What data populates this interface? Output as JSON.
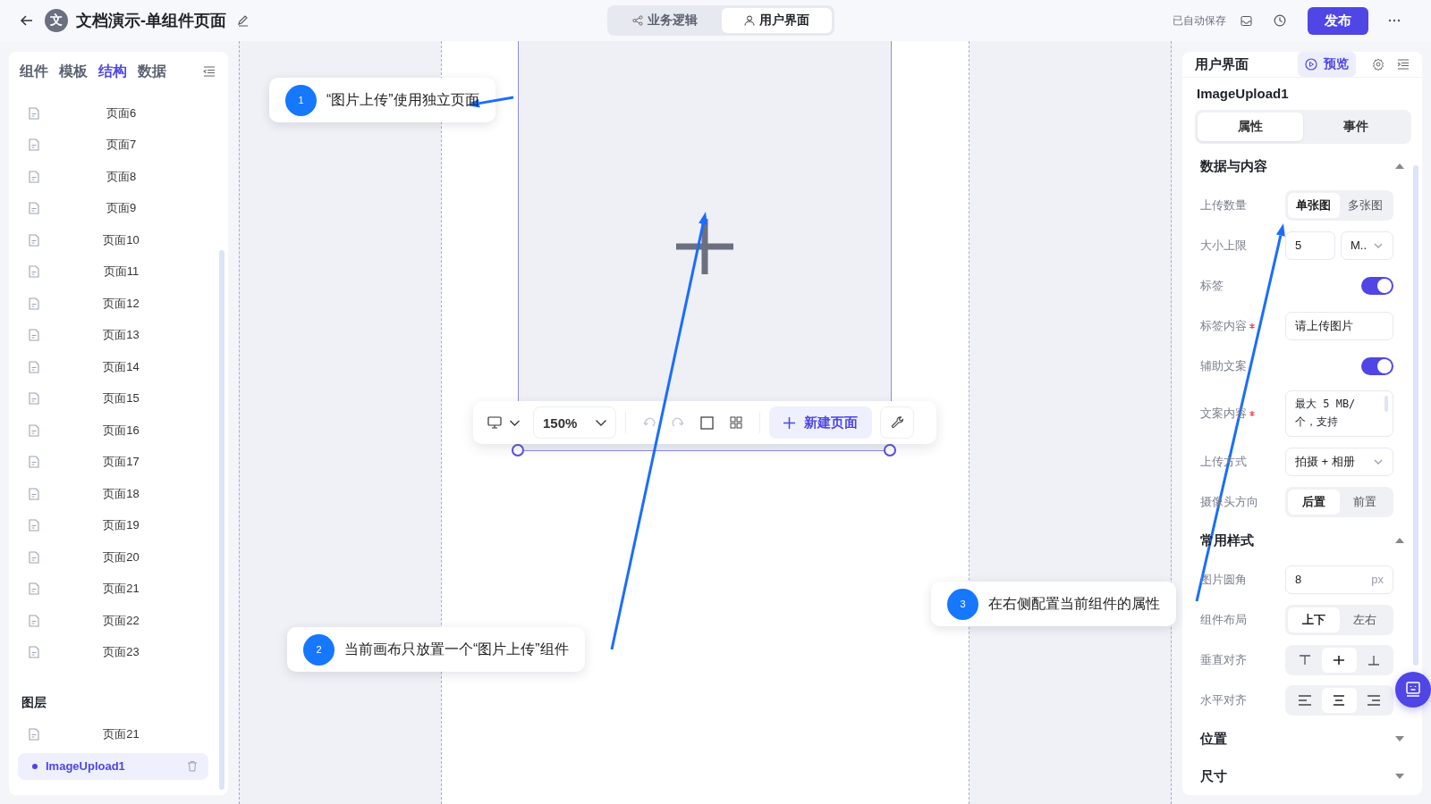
{
  "header": {
    "avatar": "文",
    "title": "文档演示-单组件页面",
    "mode_tabs": [
      {
        "label": "业务逻辑",
        "kind": "logic",
        "selected": false
      },
      {
        "label": "用户界面",
        "kind": "ui",
        "selected": true
      }
    ],
    "autosave": "已自动保存",
    "publish": "发布"
  },
  "left_panel": {
    "tabs": [
      {
        "label": "组件",
        "selected": false
      },
      {
        "label": "模板",
        "selected": false
      },
      {
        "label": "结构",
        "selected": true
      },
      {
        "label": "数据",
        "selected": false
      }
    ],
    "pages": [
      "页面6",
      "页面7",
      "页面8",
      "页面9",
      "页面10",
      "页面11",
      "页面12",
      "页面13",
      "页面14",
      "页面15",
      "页面16",
      "页面17",
      "页面18",
      "页面19",
      "页面20",
      "页面21",
      "页面22",
      "页面23"
    ],
    "layers_title": "图层",
    "layers": [
      {
        "label": "页面21",
        "kind": "page",
        "selected": false
      },
      {
        "label": "ImageUpload1",
        "kind": "component",
        "selected": true
      }
    ]
  },
  "canvas": {
    "toolbar": {
      "zoom": "150%",
      "new_page": "新建页面"
    }
  },
  "callouts": [
    {
      "number": "1",
      "text": "“图片上传”使用独立页面"
    },
    {
      "number": "2",
      "text": "当前画布只放置一个“图片上传”组件"
    },
    {
      "number": "3",
      "text": "在右侧配置当前组件的属性"
    }
  ],
  "right_panel": {
    "title": "用户界面",
    "preview": "预览",
    "component": "ImageUpload1",
    "tabs": [
      {
        "label": "属性",
        "selected": true
      },
      {
        "label": "事件",
        "selected": false
      }
    ],
    "sections": [
      {
        "title": "数据与内容",
        "expanded": true,
        "rows": [
          {
            "kind": "segmented",
            "label": "上传数量",
            "options": [
              {
                "label": "单张图",
                "selected": true
              },
              {
                "label": "多张图",
                "selected": false
              }
            ]
          },
          {
            "kind": "number_unit",
            "label": "大小上限",
            "value": "5",
            "unit": "M.."
          },
          {
            "kind": "toggle",
            "label": "标签",
            "on": true
          },
          {
            "kind": "input",
            "label": "标签内容",
            "required": true,
            "value": "请上传图片"
          },
          {
            "kind": "toggle",
            "label": "辅助文案",
            "on": true
          },
          {
            "kind": "textarea",
            "label": "文案内容",
            "required": true,
            "value": "最大 5 MB/个，支持"
          },
          {
            "kind": "select",
            "label": "上传方式",
            "value": "拍摄 + 相册"
          },
          {
            "kind": "segmented",
            "label": "摄像头方向",
            "options": [
              {
                "label": "后置",
                "selected": true
              },
              {
                "label": "前置",
                "selected": false
              }
            ]
          }
        ]
      },
      {
        "title": "常用样式",
        "expanded": true,
        "rows": [
          {
            "kind": "input_unit",
            "label": "图片圆角",
            "value": "8",
            "unit": "px"
          },
          {
            "kind": "segmented",
            "label": "组件布局",
            "options": [
              {
                "label": "上下",
                "selected": true
              },
              {
                "label": "左右",
                "selected": false
              }
            ]
          },
          {
            "kind": "align_vertical",
            "label": "垂直对齐",
            "options": [
              {
                "selected": false
              },
              {
                "selected": true
              },
              {
                "selected": false
              }
            ]
          },
          {
            "kind": "align_horizontal",
            "label": "水平对齐",
            "options": [
              {
                "selected": false
              },
              {
                "selected": true
              },
              {
                "selected": false
              }
            ]
          }
        ]
      },
      {
        "title": "位置",
        "expanded": false
      },
      {
        "title": "尺寸",
        "expanded": false
      }
    ]
  }
}
